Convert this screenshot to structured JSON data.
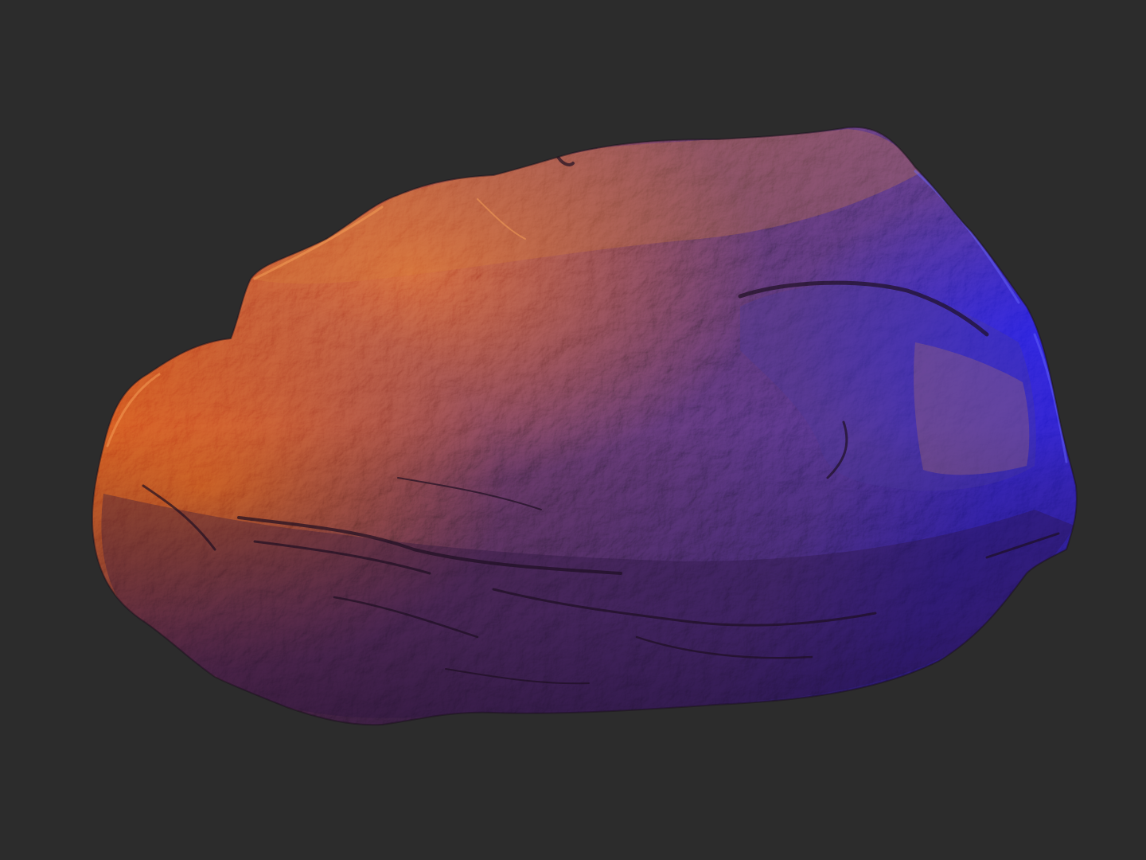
{
  "scene": {
    "subject_icon": "rock-sculpt",
    "colors": {
      "background": "#2c2c2c",
      "warm_light": "#e07a1f",
      "warm_highlight": "#f39a3a",
      "mid_tone": "#6e3f6a",
      "cool_light": "#3a2fb8",
      "deep_shadow": "#2a1530"
    }
  }
}
